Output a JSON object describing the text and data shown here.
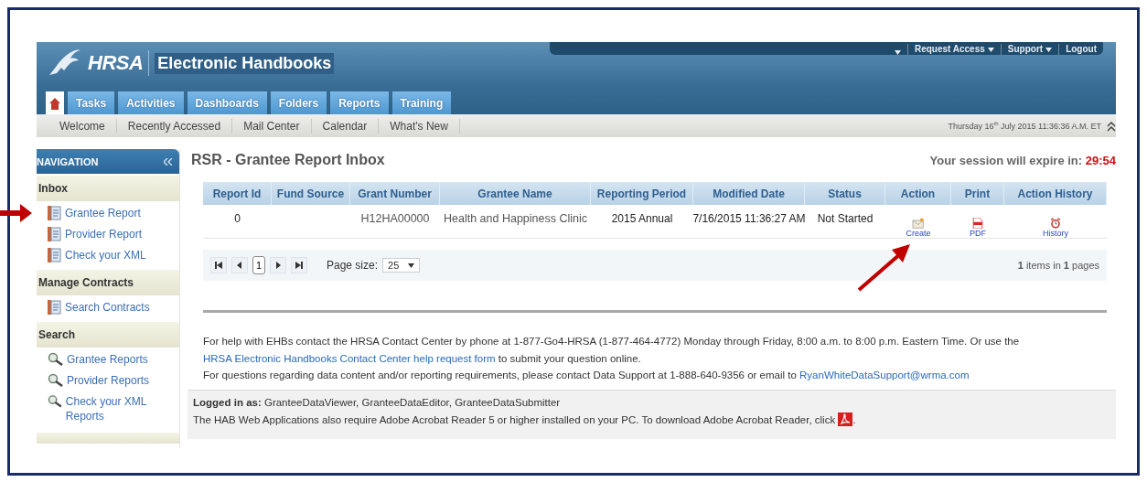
{
  "header": {
    "logo": "HRSA",
    "app_title": "Electronic Handbooks",
    "top_links": [
      {
        "label": "Request Access",
        "dropdown": true
      },
      {
        "label": "Support",
        "dropdown": true
      },
      {
        "label": "Logout",
        "dropdown": false
      }
    ],
    "tabs": [
      {
        "kind": "home",
        "selected": true
      },
      {
        "kind": "text",
        "label": "Tasks",
        "selected": false
      },
      {
        "kind": "text",
        "label": "Activities",
        "selected": false
      },
      {
        "kind": "text",
        "label": "Dashboards",
        "selected": false
      },
      {
        "kind": "text",
        "label": "Folders",
        "selected": false
      },
      {
        "kind": "text",
        "label": "Reports",
        "selected": false
      },
      {
        "kind": "text",
        "label": "Training",
        "selected": false
      }
    ]
  },
  "subnav": {
    "items": [
      "Welcome",
      "Recently Accessed",
      "Mail Center",
      "Calendar",
      "What's New"
    ],
    "date": "Thursday 16$^{th}$ July 2015 11:36:36 A.M. ET"
  },
  "sidebar": {
    "title": "NAVIGATION",
    "sections": [
      {
        "heading": "Inbox",
        "items": [
          {
            "label": "Grantee Report",
            "kind": "report"
          },
          {
            "label": "Provider Report",
            "kind": "report"
          },
          {
            "label": "Check your XML",
            "kind": "report"
          }
        ]
      },
      {
        "heading": "Manage Contracts",
        "items": [
          {
            "label": "Search Contracts",
            "kind": "report"
          }
        ]
      },
      {
        "heading": "Search",
        "items": [
          {
            "label": "Grantee Reports",
            "kind": "search"
          },
          {
            "label": "Provider Reports",
            "kind": "search"
          },
          {
            "label": "Check your XML Reports",
            "kind": "search"
          }
        ]
      }
    ]
  },
  "main": {
    "title": "RSR - Grantee Report Inbox",
    "session": {
      "label": "Your session will expire in:",
      "time": "29:54"
    },
    "table": {
      "columns": [
        "Report Id",
        "Fund Source",
        "Grant Number",
        "Grantee Name",
        "Reporting Period",
        "Modified Date",
        "Status",
        "Action",
        "Print",
        "Action History"
      ],
      "rows": [
        {
          "report_id": "0",
          "grant_number": "H12HA00000",
          "grantee_name": "Health and Happiness Clinic",
          "reporting_period": "2015 Annual",
          "modified_date": "7/16/2015 11:36:27 AM",
          "status": "Not Started",
          "action": "Create",
          "print": "PDF",
          "history": "History"
        }
      ]
    },
    "pager": {
      "pages": [
        {
          "label": "1",
          "selected": true
        }
      ],
      "page_size_label": "Page size:",
      "page_size": "25",
      "summary": "**1** items in **1** pages"
    },
    "help": [
      {
        "segments": [
          {
            "text": "For help with EHBs contact the HRSA Contact Center by phone at 1-877-Go4-HRSA (1-877-464-4772) Monday through Friday, 8:00 a.m. to 8:00 p.m. Eastern Time. Or use the "
          },
          {
            "link": "HRSA Electronic Handbooks Contact Center help request form"
          },
          {
            "text": " to submit your question online."
          }
        ]
      },
      {
        "segments": [
          {
            "text": "For questions regarding data content and/or reporting requirements, please contact Data Support at 1-888-640-9356 or email to "
          },
          {
            "link": "RyanWhiteDataSupport@wrma.com"
          }
        ]
      }
    ],
    "footer": {
      "logged_in": "**Logged in as:** GranteeDataViewer, GranteeDataEditor, GranteeDataSubmitter",
      "acrobat": "The HAB Web Applications also require Adobe Acrobat Reader 5 or higher installed on your PC. To download Adobe Acrobat Reader, click",
      "acrobat_end": "."
    }
  }
}
